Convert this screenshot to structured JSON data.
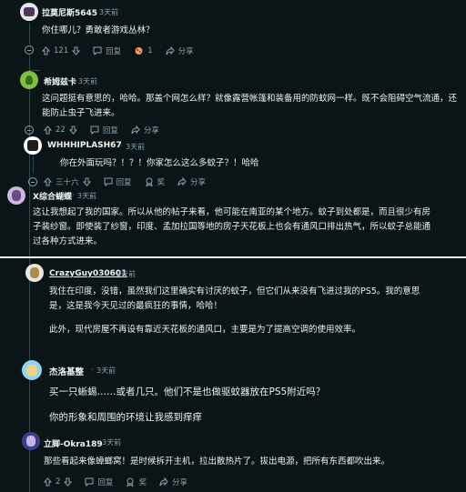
{
  "comments": [
    {
      "user": "拉莫尼斯5645",
      "time": "3天前",
      "text": [
        "你住哪儿？勇敢者游戏丛林？"
      ],
      "votes": "121",
      "reply": "回复",
      "award_count": "1",
      "share": "分享"
    },
    {
      "user": "希姆兹卡",
      "time": "3天前",
      "text": [
        "这问题挺有意思的，哈哈。那盖个网怎么样？就像露营帐篷和装备用的防蚊网一样。既不会阻碍空气流通，还",
        "能防止虫子飞进来。"
      ],
      "votes": "22",
      "reply": "回复",
      "share": "分享"
    },
    {
      "user": "WHHHIPLASH67",
      "time": "3天前",
      "text": [
        "你在外面玩吗？！？！你家怎么这么多蚊子？！哈哈"
      ],
      "votes": "三十六",
      "reply": "回复",
      "award": "奖",
      "share": "分享"
    },
    {
      "user": "X综合蝴蝶",
      "time": "3天前",
      "text": [
        "这让我想起了我的国家。所以从他的帖子来看，他可能在南亚的某个地方。蚊子到处都是，而且很少有房",
        "子装纱窗。即使装了纱窗，印度、孟加拉国等地的房子天花板上也会有通风口排出热气，所以蚊子总能通",
        "过各种方式进来。"
      ],
      "votes": "三",
      "reply": "回复",
      "award": "奖",
      "share": "分享"
    },
    {
      "user": "CrazyGuy030601",
      "time": "3天前",
      "text": [
        "我住在印度，没错，虽然我们这里确实有讨厌的蚊子，但它们从来没有飞进过我的PS5。我的意思",
        "是，这是我今天见过的最疯狂的事情，哈哈！",
        "",
        "此外，现代房屋不再设有靠近天花板的通风口，主要是为了提高空调的使用效率。"
      ]
    },
    {
      "user": "杰洛基整",
      "time": "3天前",
      "text": [
        "买一只蜥蜴……或者几只。他们不是也做驱蚊器放在PS5附近吗？",
        "",
        "你的形象和周围的环境让我感到痒痒"
      ]
    },
    {
      "user": "立脚-Okra189",
      "time": "3天前",
      "text": [
        "那些看起来像蟑螂窝！是时候拆开主机，拉出散热片了。拔出电源，把所有东西都吹出来。"
      ],
      "votes": "2",
      "reply": "回复",
      "award": "奖",
      "share": "分享"
    }
  ],
  "colors": {
    "background": "#0b1416",
    "text": "#f0f2f3",
    "meta": "#8ba2ad",
    "thread": "#33464c"
  }
}
